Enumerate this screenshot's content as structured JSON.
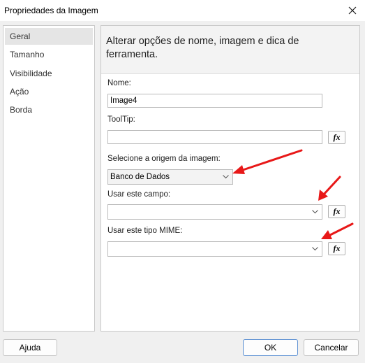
{
  "window": {
    "title": "Propriedades da Imagem",
    "close_icon": "close-icon"
  },
  "sidebar": {
    "items": [
      {
        "label": "Geral",
        "selected": true
      },
      {
        "label": "Tamanho"
      },
      {
        "label": "Visibilidade"
      },
      {
        "label": "Ação"
      },
      {
        "label": "Borda"
      }
    ]
  },
  "panel": {
    "header": "Alterar opções de nome, imagem e dica de ferramenta.",
    "name_label": "Nome:",
    "name_value": "Image4",
    "tooltip_label": "ToolTip:",
    "tooltip_value": "",
    "source_label": "Selecione a origem da imagem:",
    "source_value": "Banco de Dados",
    "field_label": "Usar este campo:",
    "field_value": "",
    "mime_label": "Usar este tipo MIME:",
    "mime_value": "",
    "fx_label": "fx"
  },
  "footer": {
    "help_label": "Ajuda",
    "ok_label": "OK",
    "cancel_label": "Cancelar"
  },
  "colors": {
    "annotation_arrow": "#e81818",
    "primary_button_border": "#5b8fd2"
  }
}
